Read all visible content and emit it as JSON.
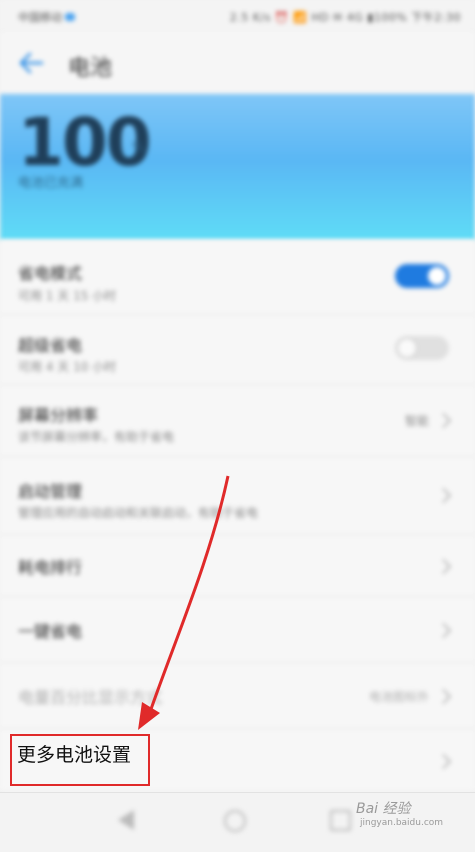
{
  "status_bar": {
    "carrier": "中国移动",
    "right_text": "2.5 K/s ⏰ 📶 HD ✉ 4G ▮100% 下午2:30"
  },
  "appbar": {
    "back_icon": "back-arrow-icon",
    "title": "电池"
  },
  "battery": {
    "percent": "100",
    "unit": "%",
    "status": "电池已充满",
    "gradient_top": "#7fc6f7",
    "gradient_bottom": "#5fdcf6"
  },
  "settings": {
    "power_saving": {
      "title": "省电模式",
      "subtitle": "可用 1 天 15 小时",
      "enabled": true
    },
    "ultra_saving": {
      "title": "超级省电",
      "subtitle": "可用 4 天 10 小时",
      "enabled": false
    },
    "resolution": {
      "title": "屏幕分辨率",
      "subtitle": "该节屏幕分辨率，有助于省电",
      "value": "智能"
    },
    "startup": {
      "title": "启动管理",
      "subtitle": "管理应用的自动启动和关联启动，有助于省电"
    },
    "consumption_rank": {
      "title": "耗电排行"
    },
    "one_tap": {
      "title": "一键省电"
    },
    "percent_display": {
      "title": "电量百分比显示方式",
      "value": "电池图标外"
    },
    "more": {
      "title": "更多电池设置"
    }
  },
  "annotation": {
    "box_color": "#e02a2a",
    "arrow_color": "#e02a2a"
  },
  "navbar": {
    "back_icon": "nav-back-icon",
    "home_icon": "nav-home-icon",
    "recent_icon": "nav-recent-icon"
  },
  "watermark": {
    "brand": "Bai 经验",
    "url": "jingyan.baidu.com"
  }
}
